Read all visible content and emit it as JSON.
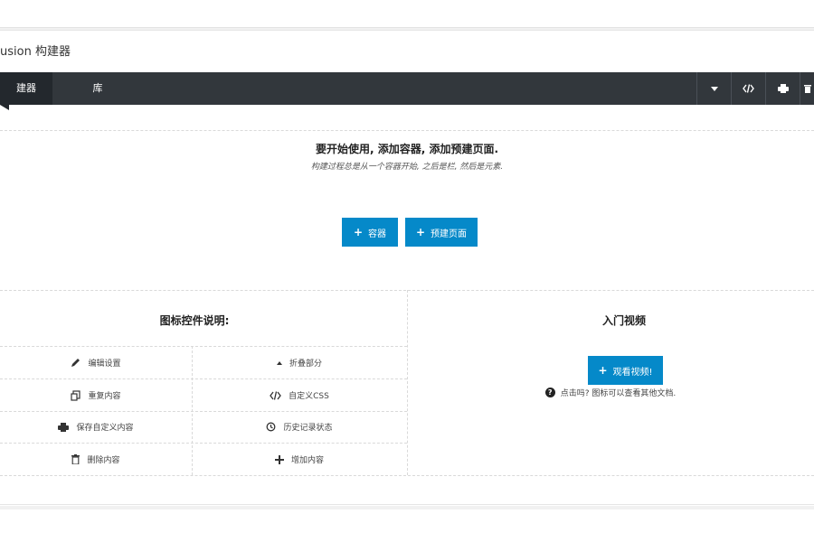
{
  "panel": {
    "title": "usion 构建器"
  },
  "toolbar": {
    "tabs": [
      {
        "label": "建器"
      },
      {
        "label": "库"
      }
    ],
    "icons": [
      "caret-down-icon",
      "code-icon",
      "printer-icon",
      "trash-icon"
    ]
  },
  "empty_state": {
    "title": "要开始使用, 添加容器, 添加预建页面.",
    "subtitle": "构建过程总是从一个容器开始, 之后是栏, 然后是元素.",
    "buttons": {
      "container": "容器",
      "prebuilt": "预建页面"
    }
  },
  "legend": {
    "title": "图标控件说明:",
    "items": [
      {
        "label": "编辑设置",
        "icon": "pencil-icon"
      },
      {
        "label": "折叠部分",
        "icon": "triangle-up-icon"
      },
      {
        "label": "重复内容",
        "icon": "clone-icon"
      },
      {
        "label": "自定义CSS",
        "icon": "code-icon"
      },
      {
        "label": "保存自定义内容",
        "icon": "printer-icon"
      },
      {
        "label": "历史记录状态",
        "icon": "history-icon"
      },
      {
        "label": "删除内容",
        "icon": "trash-icon"
      },
      {
        "label": "增加内容",
        "icon": "plus-icon"
      }
    ]
  },
  "videos": {
    "title": "入门视频",
    "button": "观看视频!",
    "help": "点击吗? 图标可以查看其他文档."
  },
  "colors": {
    "toolbar": "#32373c",
    "accent": "#0589c9"
  }
}
